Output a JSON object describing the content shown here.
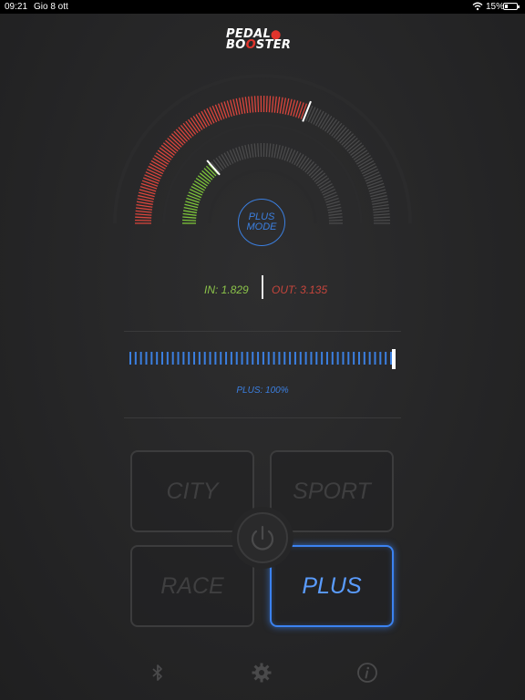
{
  "status_bar": {
    "time": "09:21",
    "date": "Gio 8 ott",
    "battery": "15%"
  },
  "logo": {
    "line1_a": "PEDAL",
    "line1_b": "⬤",
    "line2_a": "BO",
    "line2_b": "O",
    "line2_c": "STER"
  },
  "gauge": {
    "outer_fraction": 0.62,
    "inner_fraction": 0.27,
    "outer_active_color": "#d9453c",
    "inner_active_color": "#7cc43a",
    "inactive_color": "#4a4a4b"
  },
  "mode_indicator": {
    "line1": "PLUS",
    "line2": "MODE"
  },
  "readout": {
    "in": "IN: 1.829",
    "out": "OUT: 3.135"
  },
  "slider": {
    "value": 1.0,
    "color": "#3b7fe0"
  },
  "plus_label": "PLUS: 100%",
  "modes": [
    {
      "label": "CITY",
      "active": false
    },
    {
      "label": "SPORT",
      "active": false
    },
    {
      "label": "RACE",
      "active": false
    },
    {
      "label": "PLUS",
      "active": true
    }
  ],
  "icons": {
    "bluetooth": "bluetooth-icon",
    "settings": "gear-icon",
    "info": "info-icon",
    "power": "power-icon"
  }
}
